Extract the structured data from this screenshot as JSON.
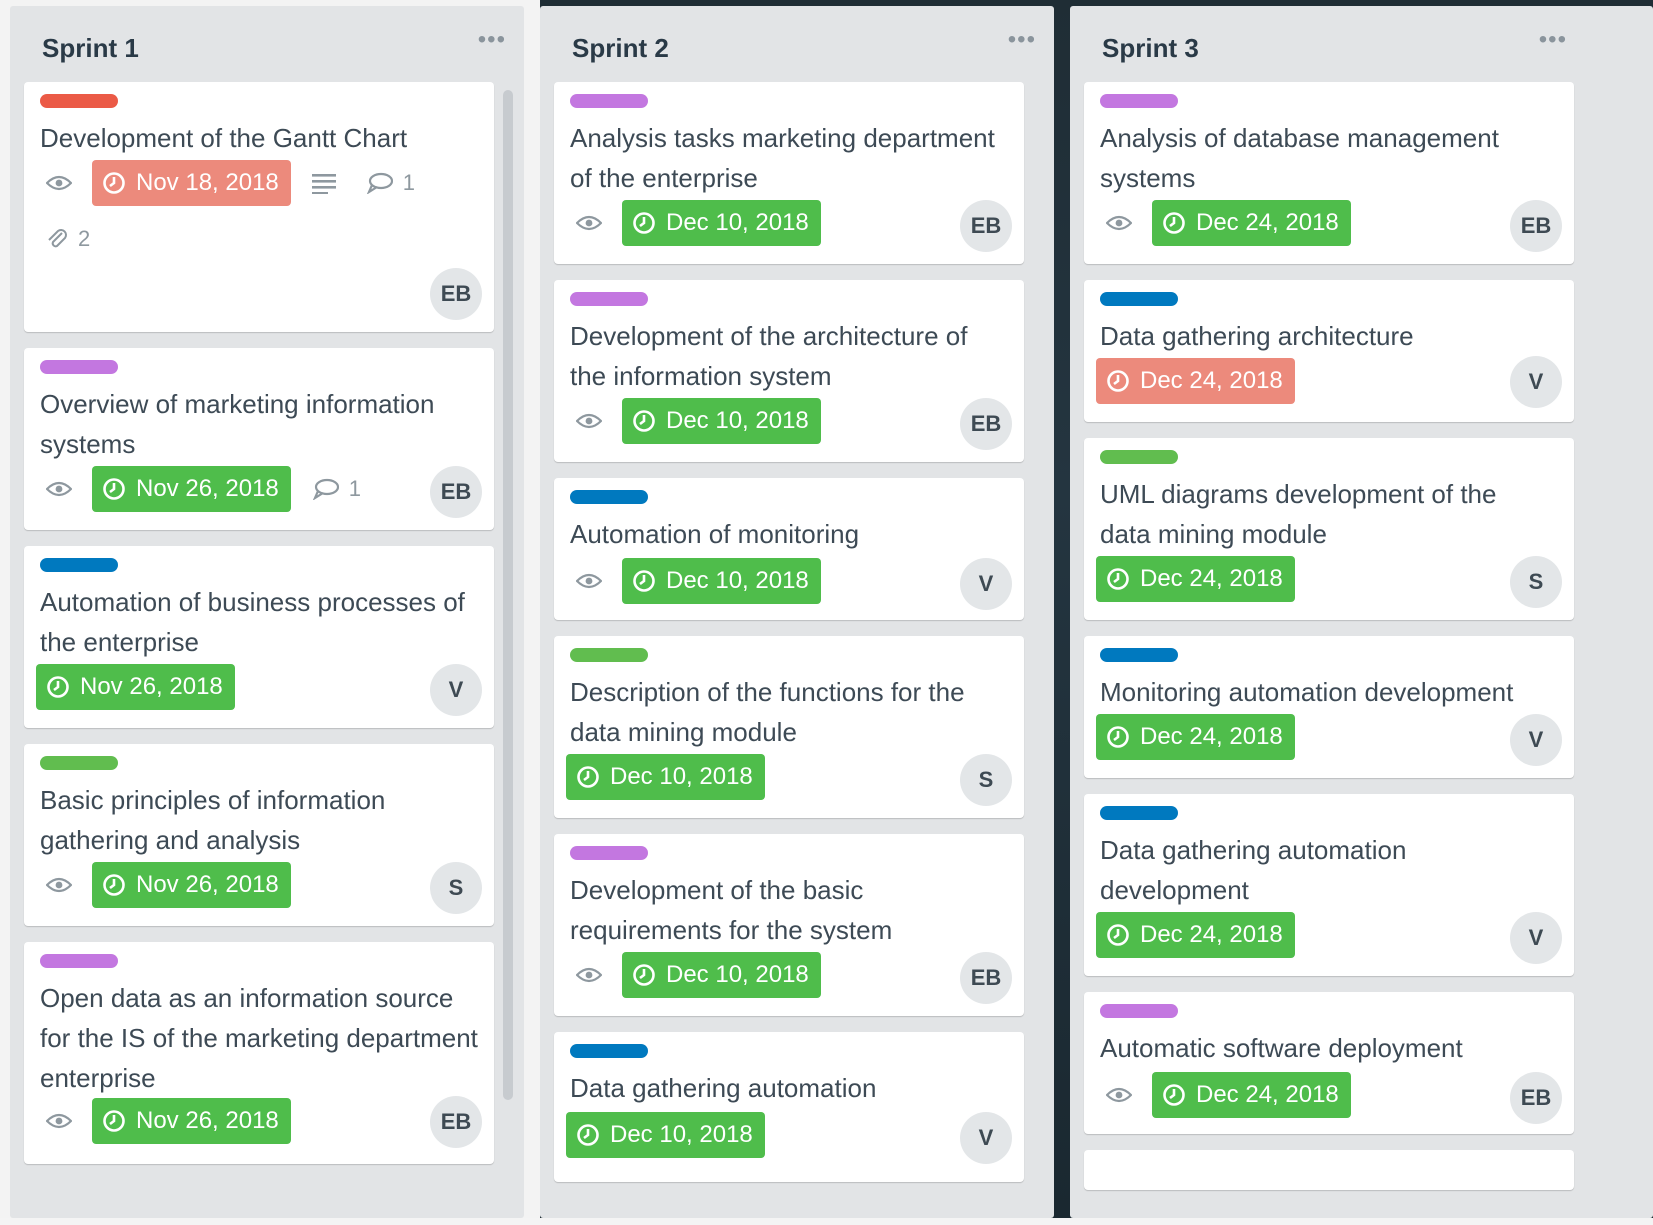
{
  "colors": {
    "purple": "#c377e0",
    "red": "#eb5a46",
    "blue": "#0079bf",
    "green": "#61bd4f",
    "due_green": "#4fbd4b",
    "due_red": "#ec8a7c"
  },
  "lists": [
    {
      "title": "Sprint 1",
      "menu": "•••",
      "cards": [
        {
          "label_color": "red",
          "title": "Development of the Gantt Chart",
          "due": "Nov 18, 2018",
          "due_status": "overdue",
          "has_description": true,
          "comments": "1",
          "attachments": "2",
          "member": "EB",
          "watching": true
        },
        {
          "label_color": "purple",
          "title": "Overview of marketing information systems",
          "due": "Nov 26, 2018",
          "due_status": "complete",
          "comments": "1",
          "member": "EB",
          "watching": true
        },
        {
          "label_color": "blue",
          "title": "Automation of business processes of the enterprise",
          "due": "Nov 26, 2018",
          "due_status": "complete",
          "member": "V",
          "watching": false
        },
        {
          "label_color": "green",
          "title": "Basic principles of information gathering and analysis",
          "due": "Nov 26, 2018",
          "due_status": "complete",
          "member": "S",
          "watching": true
        },
        {
          "label_color": "purple",
          "title": "Open data as an information source for the IS of the marketing department enterprise",
          "due": "Nov 26, 2018",
          "due_status": "complete",
          "member": "EB",
          "watching": true
        }
      ]
    },
    {
      "title": "Sprint 2",
      "menu": "•••",
      "cards": [
        {
          "label_color": "purple",
          "title": "Analysis tasks marketing department of the enterprise",
          "due": "Dec 10, 2018",
          "due_status": "complete",
          "member": "EB",
          "watching": true
        },
        {
          "label_color": "purple",
          "title": "Development of the architecture of the information system",
          "due": "Dec 10, 2018",
          "due_status": "complete",
          "member": "EB",
          "watching": true
        },
        {
          "label_color": "blue",
          "title": "Automation of monitoring",
          "due": "Dec 10, 2018",
          "due_status": "complete",
          "member": "V",
          "watching": true
        },
        {
          "label_color": "green",
          "title": "Description of the functions for the data mining module",
          "due": "Dec 10, 2018",
          "due_status": "complete",
          "member": "S",
          "watching": false
        },
        {
          "label_color": "purple",
          "title": "Development of the basic requirements for the system",
          "due": "Dec 10, 2018",
          "due_status": "complete",
          "member": "EB",
          "watching": true
        },
        {
          "label_color": "blue",
          "title": "Data gathering automation",
          "due": "Dec 10, 2018",
          "due_status": "complete",
          "member": "V",
          "watching": false
        }
      ]
    },
    {
      "title": "Sprint 3",
      "menu": "•••",
      "cards": [
        {
          "label_color": "purple",
          "title": "Analysis of database management systems",
          "due": "Dec 24, 2018",
          "due_status": "complete",
          "member": "EB",
          "watching": true
        },
        {
          "label_color": "blue",
          "title": "Data gathering architecture",
          "due": "Dec 24, 2018",
          "due_status": "overdue",
          "member": "V",
          "watching": false
        },
        {
          "label_color": "green",
          "title": "UML diagrams development of the data mining module",
          "due": "Dec 24, 2018",
          "due_status": "complete",
          "member": "S",
          "watching": false
        },
        {
          "label_color": "blue",
          "title": "Monitoring automation development",
          "due": "Dec 24, 2018",
          "due_status": "complete",
          "member": "V",
          "watching": false
        },
        {
          "label_color": "blue",
          "title": "Data gathering automation development",
          "due": "Dec 24, 2018",
          "due_status": "complete",
          "member": "V",
          "watching": false
        },
        {
          "label_color": "purple",
          "title": "Automatic software deployment",
          "due": "Dec 24, 2018",
          "due_status": "complete",
          "member": "EB",
          "watching": true
        }
      ]
    }
  ]
}
